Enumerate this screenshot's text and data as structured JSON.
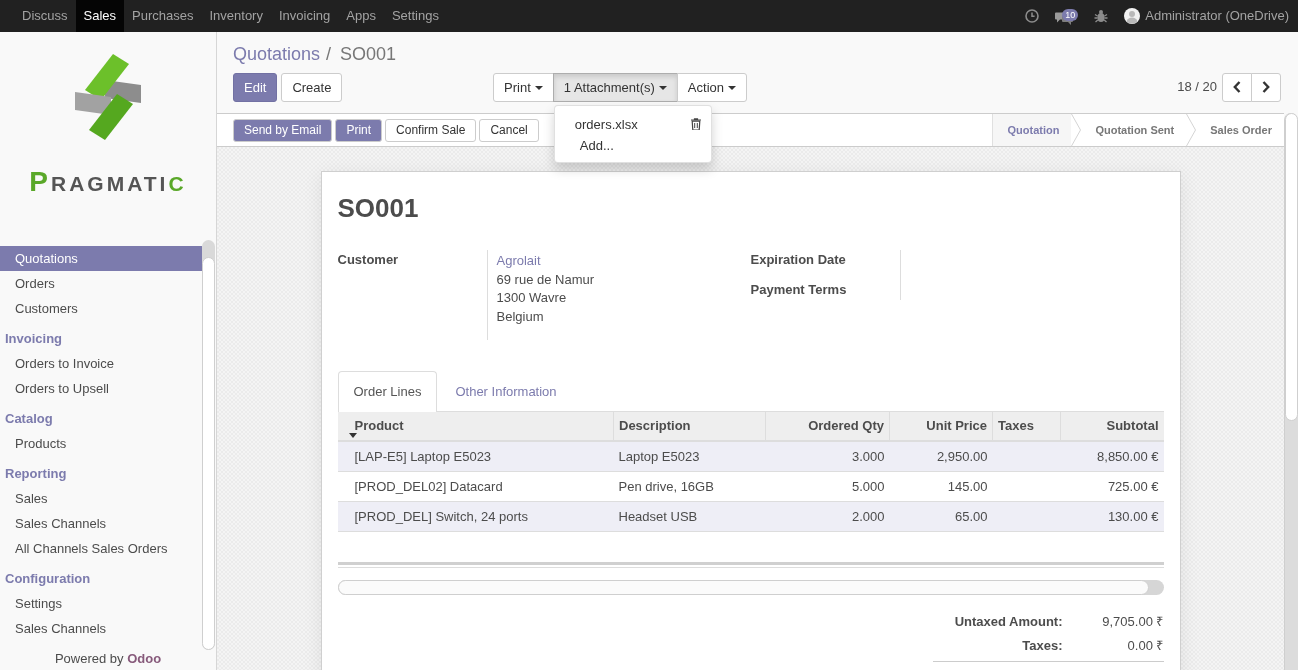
{
  "navbar": {
    "apps": [
      {
        "label": "Discuss",
        "selected": false
      },
      {
        "label": "Sales",
        "selected": true
      },
      {
        "label": "Purchases",
        "selected": false
      },
      {
        "label": "Inventory",
        "selected": false
      },
      {
        "label": "Invoicing",
        "selected": false
      },
      {
        "label": "Apps",
        "selected": false
      },
      {
        "label": "Settings",
        "selected": false
      }
    ],
    "messages_badge": "10",
    "user": "Administrator (OneDrive)"
  },
  "sidebar": {
    "logo_text": "PRAGMATIC",
    "sections": [
      {
        "items": [
          {
            "label": "Quotations",
            "selected": true
          },
          {
            "label": "Orders",
            "selected": false
          },
          {
            "label": "Customers",
            "selected": false
          }
        ]
      },
      {
        "title": "Invoicing",
        "items": [
          {
            "label": "Orders to Invoice",
            "selected": false
          },
          {
            "label": "Orders to Upsell",
            "selected": false
          }
        ]
      },
      {
        "title": "Catalog",
        "items": [
          {
            "label": "Products",
            "selected": false
          }
        ]
      },
      {
        "title": "Reporting",
        "items": [
          {
            "label": "Sales",
            "selected": false
          },
          {
            "label": "Sales Channels",
            "selected": false
          },
          {
            "label": "All Channels Sales Orders",
            "selected": false
          }
        ]
      },
      {
        "title": "Configuration",
        "items": [
          {
            "label": "Settings",
            "selected": false
          },
          {
            "label": "Sales Channels",
            "selected": false
          }
        ]
      }
    ],
    "footer": "Powered by **Odoo**"
  },
  "breadcrumb": {
    "items": [
      "Quotations",
      "SO001"
    ],
    "separator": "/"
  },
  "buttons": [
    {
      "label": "Edit",
      "kind": "primary"
    },
    {
      "label": "Create",
      "kind": "default"
    }
  ],
  "sidebar_menus": [
    {
      "label": "Print",
      "expanded": false
    },
    {
      "label": "1 Attachment(s)",
      "expanded": true,
      "menu": [
        {
          "label": "orders.xlsx",
          "kind": "file"
        },
        {
          "label": "Add...",
          "kind": "action"
        }
      ]
    },
    {
      "label": "Action",
      "expanded": false
    }
  ],
  "pager": {
    "value": "18 / 20"
  },
  "statusbar": {
    "buttons": [
      {
        "label": "Send by Email",
        "kind": "primary"
      },
      {
        "label": "Print",
        "kind": "primary"
      },
      {
        "label": "Confirm Sale",
        "kind": "default"
      },
      {
        "label": "Cancel",
        "kind": "default"
      }
    ],
    "stages": [
      {
        "label": "Quotation",
        "selected": true
      },
      {
        "label": "Quotation Sent",
        "selected": false
      },
      {
        "label": "Sales Order",
        "selected": false
      }
    ]
  },
  "sheet": {
    "title": "SO001",
    "customer": {
      "label": "Customer",
      "name": "Agrolait",
      "address": [
        "69 rue de Namur",
        "1300 Wavre",
        "Belgium"
      ]
    },
    "fields": [
      {
        "label": "Expiration Date"
      },
      {
        "label": "Payment Terms"
      }
    ],
    "tabs": [
      {
        "label": "Order Lines",
        "selected": true
      },
      {
        "label": "Other Information",
        "selected": false
      }
    ],
    "table": {
      "columns": [
        {
          "label": "Product",
          "kind": "text",
          "sorted": true
        },
        {
          "label": "Description",
          "kind": "text",
          "sorted": false
        },
        {
          "label": "Ordered Qty",
          "kind": "number",
          "sorted": false
        },
        {
          "label": "Unit Price",
          "kind": "number",
          "sorted": false
        },
        {
          "label": "Taxes",
          "kind": "text",
          "sorted": false
        },
        {
          "label": "Subtotal",
          "kind": "number",
          "sorted": false
        }
      ],
      "rows": [
        [
          "[LAP-E5] Laptop E5023",
          "Laptop E5023",
          "3.000",
          "2,950.00",
          "",
          "8,850.00 €"
        ],
        [
          "[PROD_DEL02] Datacard",
          "Pen drive, 16GB",
          "5.000",
          "145.00",
          "",
          "725.00 €"
        ],
        [
          "[PROD_DEL] Switch, 24 ports",
          "Headset USB",
          "2.000",
          "65.00",
          "",
          "130.00 €"
        ]
      ]
    },
    "totals": [
      {
        "label": "Untaxed Amount:",
        "value": "9,705.00 ₹"
      },
      {
        "label": "Taxes:",
        "value": "0.00 ₹"
      }
    ]
  }
}
